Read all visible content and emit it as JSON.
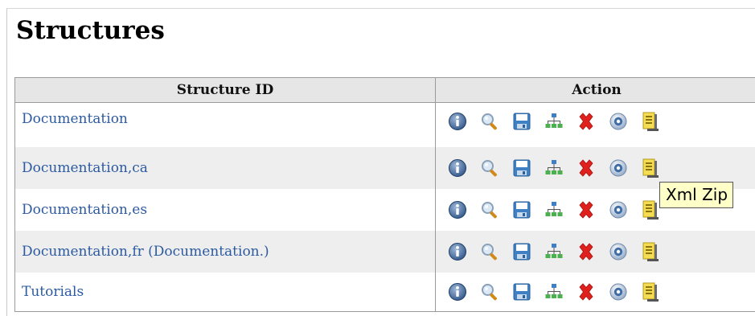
{
  "page": {
    "title": "Structures"
  },
  "table": {
    "headers": [
      "Structure ID",
      "Action"
    ],
    "rows": [
      {
        "id": "Documentation"
      },
      {
        "id": "Documentation,ca"
      },
      {
        "id": "Documentation,es"
      },
      {
        "id": "Documentation,fr (Documentation.)"
      },
      {
        "id": "Tutorials"
      }
    ],
    "actions": [
      {
        "icon": "info-icon"
      },
      {
        "icon": "view-icon"
      },
      {
        "icon": "save-icon"
      },
      {
        "icon": "hierarchy-icon"
      },
      {
        "icon": "delete-icon"
      },
      {
        "icon": "help-icon"
      },
      {
        "icon": "xml-zip-icon"
      }
    ]
  },
  "tooltip": {
    "text": "Xml Zip"
  },
  "colors": {
    "link": "#2c5aa0",
    "header_bg": "#e6e6e6",
    "alt_row_bg": "#eeeeee",
    "tooltip_bg": "#ffffc8"
  }
}
